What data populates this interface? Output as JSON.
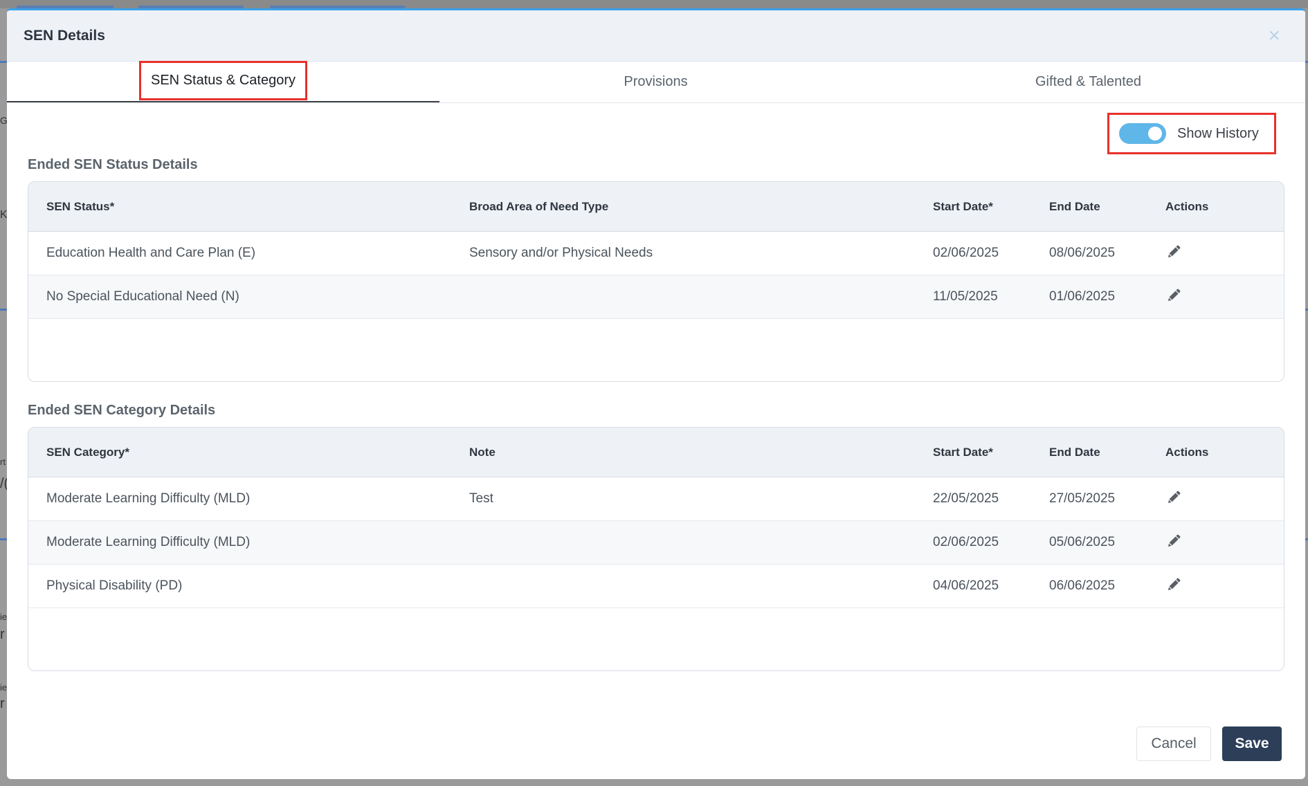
{
  "modal": {
    "title": "SEN Details",
    "close_icon": "close-icon"
  },
  "tabs": [
    {
      "label": "SEN Status & Category",
      "active": true
    },
    {
      "label": "Provisions",
      "active": false
    },
    {
      "label": "Gifted & Talented",
      "active": false
    }
  ],
  "history_toggle": {
    "label": "Show History",
    "on": true
  },
  "status_section": {
    "title": "Ended SEN Status Details",
    "headers": [
      "SEN Status*",
      "Broad Area of Need Type",
      "Start Date*",
      "End Date",
      "Actions"
    ],
    "rows": [
      [
        "Education Health and Care Plan (E)",
        "Sensory and/or Physical Needs",
        "02/06/2025",
        "08/06/2025"
      ],
      [
        "No Special Educational Need (N)",
        "",
        "11/05/2025",
        "01/06/2025"
      ]
    ]
  },
  "category_section": {
    "title": "Ended SEN Category Details",
    "headers": [
      "SEN Category*",
      "Note",
      "Start Date*",
      "End Date",
      "Actions"
    ],
    "rows": [
      [
        "Moderate Learning Difficulty (MLD)",
        "Test",
        "22/05/2025",
        "27/05/2025"
      ],
      [
        "Moderate Learning Difficulty (MLD)",
        "",
        "02/06/2025",
        "05/06/2025"
      ],
      [
        "Physical Disability (PD)",
        "",
        "04/06/2025",
        "06/06/2025"
      ]
    ]
  },
  "footer": {
    "cancel_label": "Cancel",
    "save_label": "Save"
  },
  "colors": {
    "accent": "#5fb6e8",
    "save_bg": "#2c3e58",
    "highlight": "#e8302a"
  },
  "background_fragments": [
    "G",
    "K",
    "rt",
    "/(",
    "ie",
    "r",
    "ie",
    "r"
  ]
}
